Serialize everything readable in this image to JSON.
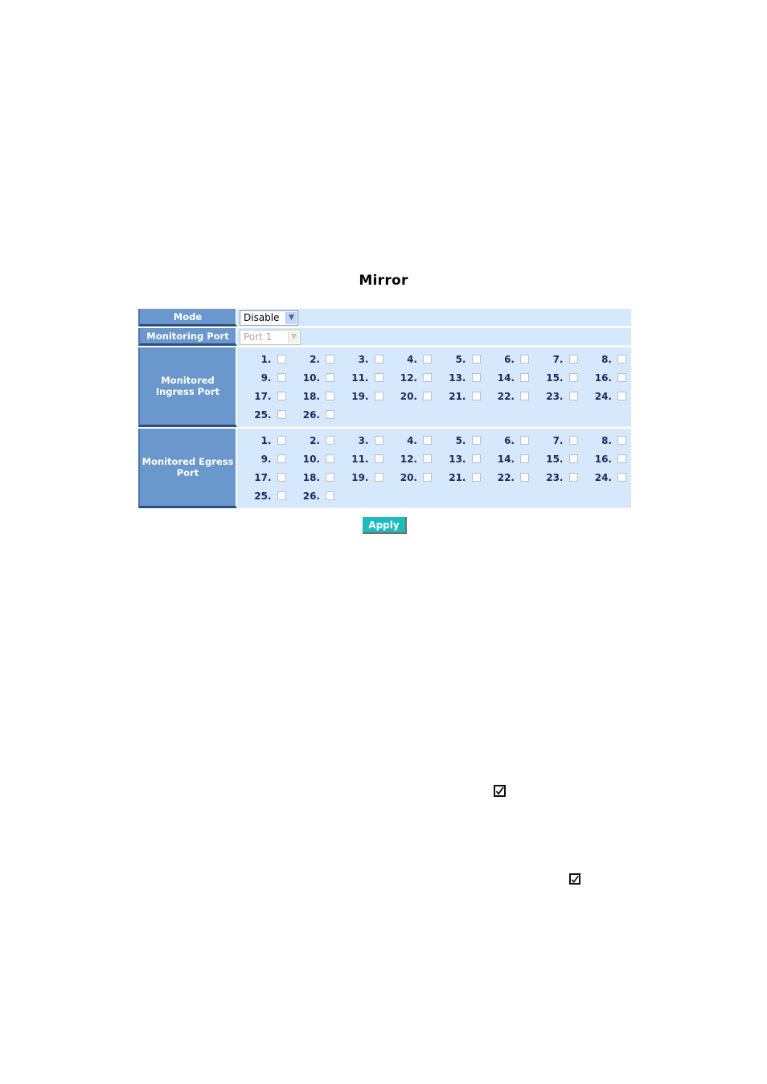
{
  "page": {
    "title": "Mirror"
  },
  "rows": {
    "mode": {
      "label": "Mode",
      "value": "Disable",
      "enabled": true
    },
    "monitoring_port": {
      "label": "Monitoring Port",
      "value": "Port 1",
      "enabled": false
    },
    "ingress": {
      "label": "Monitored Ingress Port",
      "ports": [
        {
          "label": "1.",
          "checked": false
        },
        {
          "label": "2.",
          "checked": false
        },
        {
          "label": "3.",
          "checked": false
        },
        {
          "label": "4.",
          "checked": false
        },
        {
          "label": "5.",
          "checked": false
        },
        {
          "label": "6.",
          "checked": false
        },
        {
          "label": "7.",
          "checked": false
        },
        {
          "label": "8.",
          "checked": false
        },
        {
          "label": "9.",
          "checked": false
        },
        {
          "label": "10.",
          "checked": false
        },
        {
          "label": "11.",
          "checked": false
        },
        {
          "label": "12.",
          "checked": false
        },
        {
          "label": "13.",
          "checked": false
        },
        {
          "label": "14.",
          "checked": false
        },
        {
          "label": "15.",
          "checked": false
        },
        {
          "label": "16.",
          "checked": false
        },
        {
          "label": "17.",
          "checked": false
        },
        {
          "label": "18.",
          "checked": false
        },
        {
          "label": "19.",
          "checked": false
        },
        {
          "label": "20.",
          "checked": false
        },
        {
          "label": "21.",
          "checked": false
        },
        {
          "label": "22.",
          "checked": false
        },
        {
          "label": "23.",
          "checked": false
        },
        {
          "label": "24.",
          "checked": false
        },
        {
          "label": "25.",
          "checked": false
        },
        {
          "label": "26.",
          "checked": false
        }
      ]
    },
    "egress": {
      "label": "Monitored Egress Port",
      "ports": [
        {
          "label": "1.",
          "checked": false
        },
        {
          "label": "2.",
          "checked": false
        },
        {
          "label": "3.",
          "checked": false
        },
        {
          "label": "4.",
          "checked": false
        },
        {
          "label": "5.",
          "checked": false
        },
        {
          "label": "6.",
          "checked": false
        },
        {
          "label": "7.",
          "checked": false
        },
        {
          "label": "8.",
          "checked": false
        },
        {
          "label": "9.",
          "checked": false
        },
        {
          "label": "10.",
          "checked": false
        },
        {
          "label": "11.",
          "checked": false
        },
        {
          "label": "12.",
          "checked": false
        },
        {
          "label": "13.",
          "checked": false
        },
        {
          "label": "14.",
          "checked": false
        },
        {
          "label": "15.",
          "checked": false
        },
        {
          "label": "16.",
          "checked": false
        },
        {
          "label": "17.",
          "checked": false
        },
        {
          "label": "18.",
          "checked": false
        },
        {
          "label": "19.",
          "checked": false
        },
        {
          "label": "20.",
          "checked": false
        },
        {
          "label": "21.",
          "checked": false
        },
        {
          "label": "22.",
          "checked": false
        },
        {
          "label": "23.",
          "checked": false
        },
        {
          "label": "24.",
          "checked": false
        },
        {
          "label": "25.",
          "checked": false
        },
        {
          "label": "26.",
          "checked": false
        }
      ]
    }
  },
  "apply_label": "Apply",
  "icons": {
    "select_arrow": "chevron-down-icon",
    "doc_check": "checked-box-icon"
  },
  "colors": {
    "label_bg": "#6a97cc",
    "value_bg": "#d6e8fb",
    "apply_bg": "#1dbbbd"
  }
}
